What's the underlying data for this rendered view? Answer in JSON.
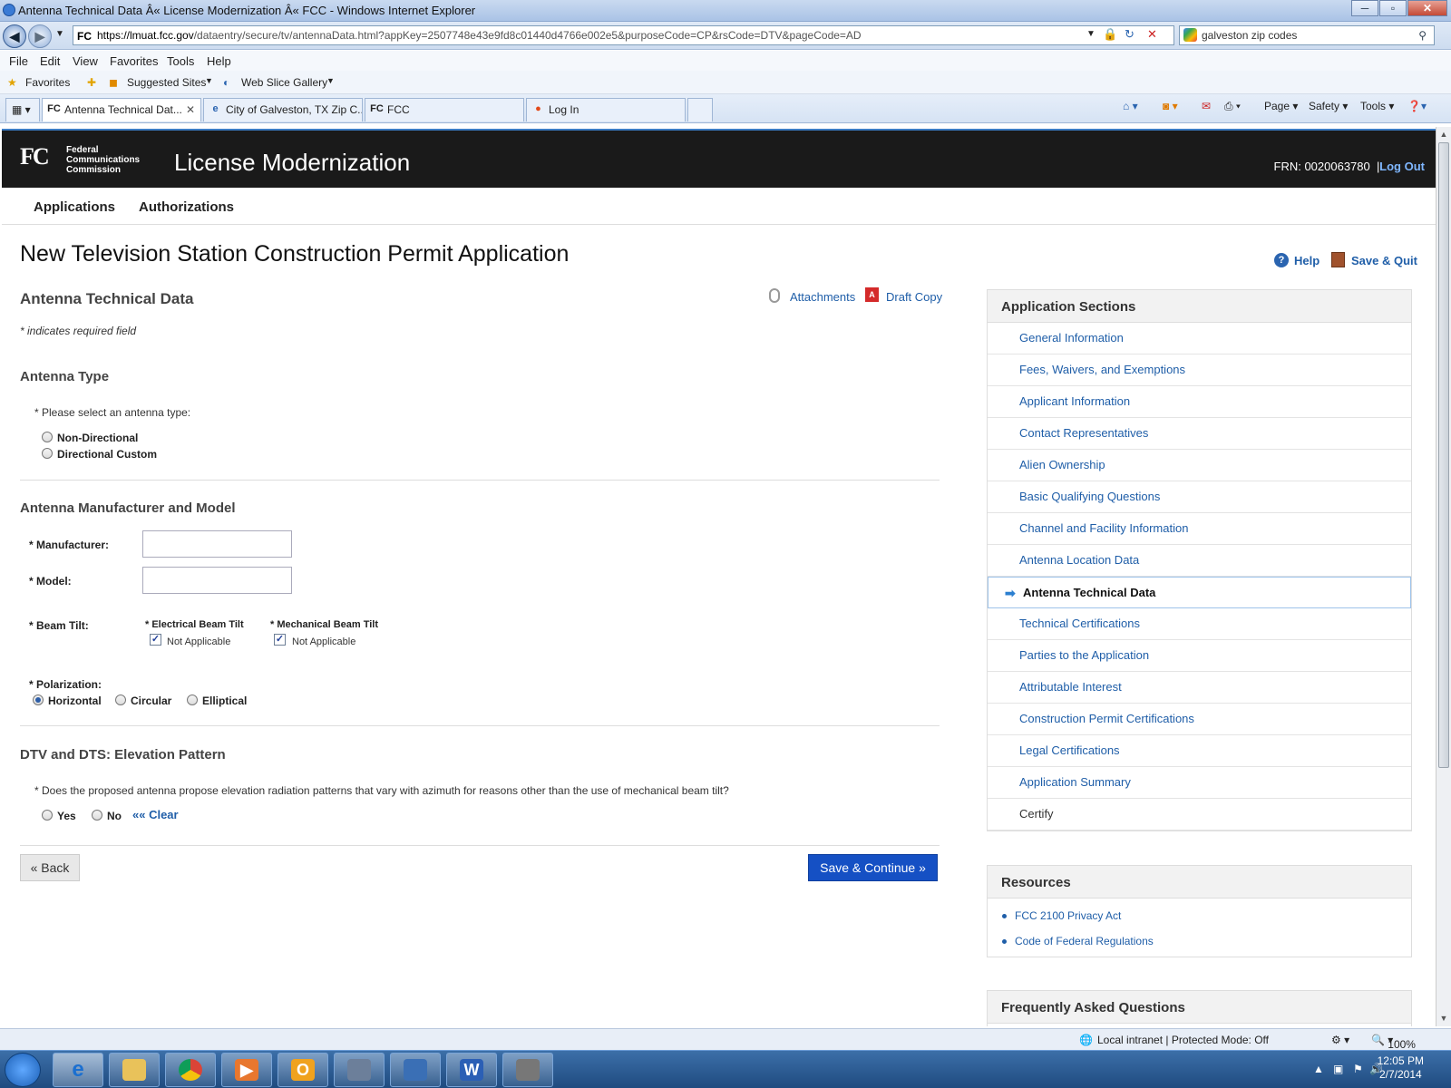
{
  "window": {
    "title": "Antenna Technical Data Â« License Modernization Â« FCC - Windows Internet Explorer"
  },
  "address": {
    "favicon": "FC",
    "url_host": "https://lmuat.fcc.gov",
    "url_path": "/dataentry/secure/tv/antennaData.html?appKey=2507748e43e9fd8c01440d4766e002e5&purposeCode=CP&rsCode=DTV&pageCode=AD",
    "search_value": "galveston zip codes"
  },
  "menu": [
    "File",
    "Edit",
    "View",
    "Favorites",
    "Tools",
    "Help"
  ],
  "favorites_bar": {
    "favorites": "Favorites",
    "suggested": "Suggested Sites",
    "webslice": "Web Slice Gallery"
  },
  "tabs": [
    {
      "label": "Antenna Technical Dat...",
      "icon": "FC"
    },
    {
      "label": "City of Galveston, TX Zip C...",
      "icon": "e"
    },
    {
      "label": "FCC",
      "icon": "FC"
    },
    {
      "label": "Log In",
      "icon": "●"
    }
  ],
  "ie_toolbar": {
    "page": "Page",
    "safety": "Safety",
    "tools": "Tools"
  },
  "header": {
    "logo": "FC",
    "org_line1": "Federal",
    "org_line2": "Communications",
    "org_line3": "Commission",
    "app_name": "License Modernization",
    "frn": "FRN: 0020063780",
    "separator": "|",
    "logout": "Log Out"
  },
  "subnav": {
    "applications": "Applications",
    "authorizations": "Authorizations"
  },
  "page": {
    "title": "New Television Station Construction Permit Application",
    "help": "Help",
    "save_quit": "Save & Quit"
  },
  "form": {
    "section_title": "Antenna Technical Data",
    "attachments": "Attachments",
    "draft_copy": "Draft Copy",
    "required_note": "* indicates required field",
    "antenna_type": {
      "heading": "Antenna Type",
      "prompt": "* Please select an antenna type:",
      "options": [
        "Non-Directional",
        "Directional Custom"
      ]
    },
    "manufacturer_model": {
      "heading": "Antenna Manufacturer and Model",
      "manufacturer_label": "* Manufacturer:",
      "manufacturer_value": "",
      "model_label": "* Model:",
      "model_value": ""
    },
    "beam_tilt": {
      "label": "* Beam Tilt:",
      "electrical": "* Electrical Beam Tilt",
      "mechanical": "* Mechanical Beam Tilt",
      "electrical_na": "Not Applicable",
      "mechanical_na": "Not Applicable",
      "electrical_checked": true,
      "mechanical_checked": true
    },
    "polarization": {
      "label": "* Polarization:",
      "options": [
        "Horizontal",
        "Circular",
        "Elliptical"
      ],
      "selected": "Horizontal"
    },
    "elevation": {
      "heading": "DTV and DTS: Elevation Pattern",
      "question": "* Does the proposed antenna propose elevation radiation patterns that vary with azimuth for reasons other than the use of mechanical beam tilt?",
      "yes": "Yes",
      "no": "No",
      "clear": "«« Clear"
    },
    "back": "« Back",
    "save_continue": "Save & Continue »"
  },
  "sidebar": {
    "sections_title": "Application Sections",
    "sections": [
      "General Information",
      "Fees, Waivers, and Exemptions",
      "Applicant Information",
      "Contact Representatives",
      "Alien Ownership",
      "Basic Qualifying Questions",
      "Channel and Facility Information",
      "Antenna Location Data",
      "Antenna Technical Data",
      "Technical Certifications",
      "Parties to the Application",
      "Attributable Interest",
      "Construction Permit Certifications",
      "Legal Certifications",
      "Application Summary",
      "Certify"
    ],
    "current_section": "Antenna Technical Data",
    "resources_title": "Resources",
    "resources": [
      "FCC 2100 Privacy Act",
      "Code of Federal Regulations"
    ],
    "faq_title": "Frequently Asked Questions"
  },
  "status": {
    "zone": "Local intranet | Protected Mode: Off",
    "zoom": "100%"
  },
  "clock": {
    "time": "12:05 PM",
    "date": "2/7/2014"
  }
}
